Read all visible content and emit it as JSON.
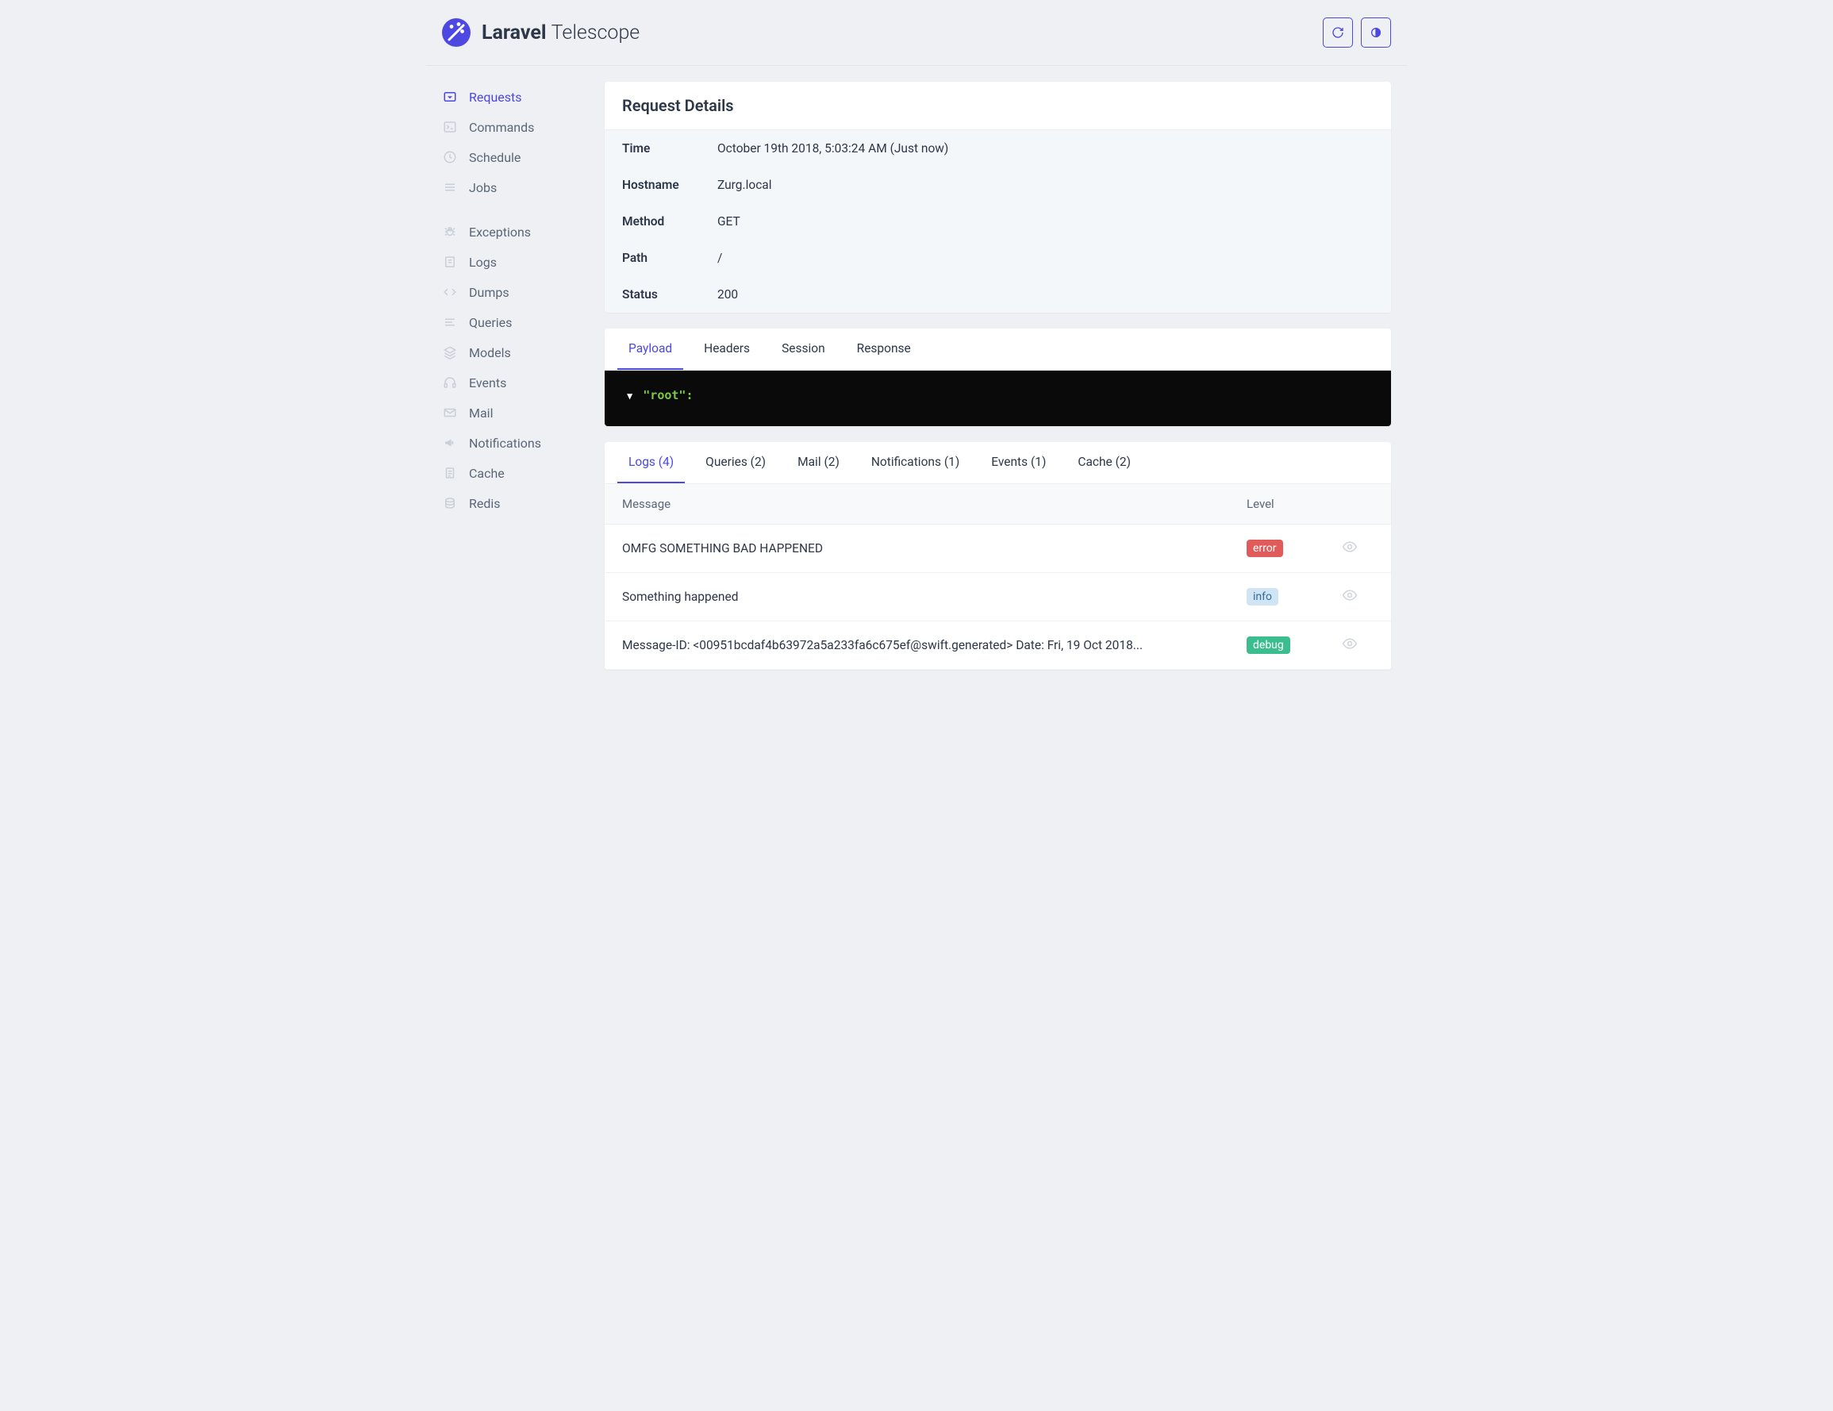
{
  "header": {
    "brand_bold": "Laravel",
    "brand_light": "Telescope"
  },
  "sidebar": {
    "group1": [
      {
        "label": "Requests",
        "icon": "request",
        "active": true
      },
      {
        "label": "Commands",
        "icon": "terminal",
        "active": false
      },
      {
        "label": "Schedule",
        "icon": "clock",
        "active": false
      },
      {
        "label": "Jobs",
        "icon": "menu",
        "active": false
      }
    ],
    "group2": [
      {
        "label": "Exceptions",
        "icon": "bug",
        "active": false
      },
      {
        "label": "Logs",
        "icon": "logs",
        "active": false
      },
      {
        "label": "Dumps",
        "icon": "code",
        "active": false
      },
      {
        "label": "Queries",
        "icon": "lines",
        "active": false
      },
      {
        "label": "Models",
        "icon": "layers",
        "active": false
      },
      {
        "label": "Events",
        "icon": "headset",
        "active": false
      },
      {
        "label": "Mail",
        "icon": "mail",
        "active": false
      },
      {
        "label": "Notifications",
        "icon": "horn",
        "active": false
      },
      {
        "label": "Cache",
        "icon": "doc",
        "active": false
      },
      {
        "label": "Redis",
        "icon": "stack",
        "active": false
      }
    ]
  },
  "request_details": {
    "title": "Request Details",
    "rows": [
      {
        "label": "Time",
        "value": "October 19th 2018, 5:03:24 AM (Just now)"
      },
      {
        "label": "Hostname",
        "value": "Zurg.local"
      },
      {
        "label": "Method",
        "value": "GET"
      },
      {
        "label": "Path",
        "value": "/"
      },
      {
        "label": "Status",
        "value": "200"
      }
    ]
  },
  "payload_tabs": [
    {
      "label": "Payload",
      "active": true
    },
    {
      "label": "Headers",
      "active": false
    },
    {
      "label": "Session",
      "active": false
    },
    {
      "label": "Response",
      "active": false
    }
  ],
  "payload": {
    "root_key": "\"root\":"
  },
  "related_tabs": [
    {
      "label": "Logs (4)",
      "active": true
    },
    {
      "label": "Queries (2)",
      "active": false
    },
    {
      "label": "Mail (2)",
      "active": false
    },
    {
      "label": "Notifications (1)",
      "active": false
    },
    {
      "label": "Events (1)",
      "active": false
    },
    {
      "label": "Cache (2)",
      "active": false
    }
  ],
  "logs_table": {
    "col_message": "Message",
    "col_level": "Level",
    "rows": [
      {
        "message": "OMFG SOMETHING BAD HAPPENED",
        "level": "error"
      },
      {
        "message": "Something happened",
        "level": "info"
      },
      {
        "message": "Message-ID: <00951bcdaf4b63972a5a233fa6c675ef@swift.generated> Date: Fri, 19 Oct 2018...",
        "level": "debug"
      }
    ]
  }
}
